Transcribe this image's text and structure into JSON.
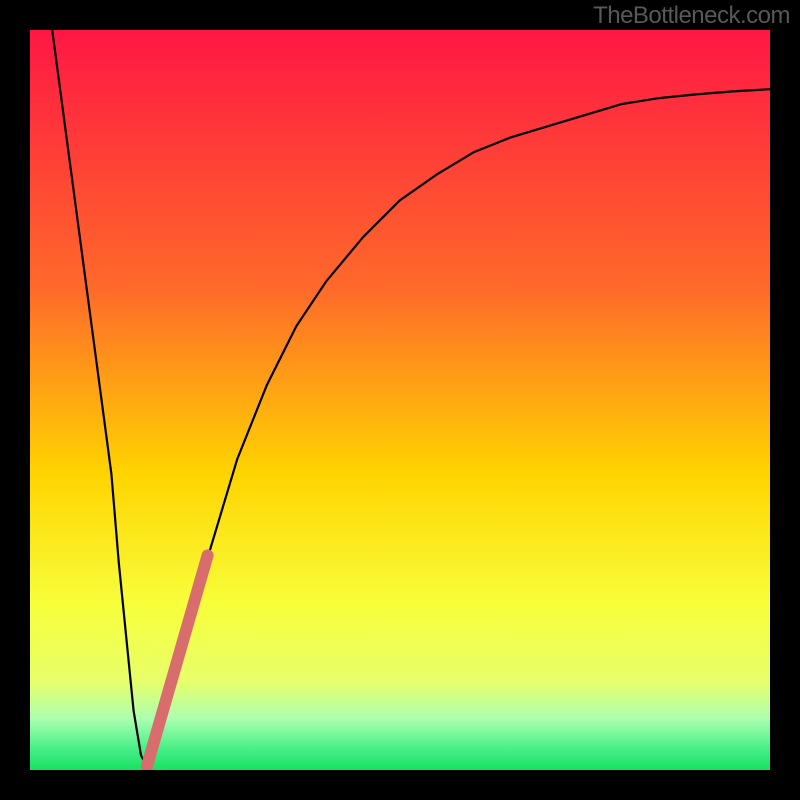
{
  "watermark": "TheBottleneck.com",
  "colors": {
    "top": "#ff1744",
    "upper_mid": "#ff6a2a",
    "mid": "#ffd400",
    "lower_mid": "#f7ff3c",
    "pale_green": "#adffb0",
    "green": "#18e060",
    "frame": "#000000",
    "curve": "#000000",
    "marker": "#d96c6c"
  },
  "chart_data": {
    "type": "line",
    "title": "",
    "xlabel": "",
    "ylabel": "",
    "xlim": [
      0,
      100
    ],
    "ylim": [
      0,
      100
    ],
    "curve": {
      "x": [
        3,
        5,
        7,
        9,
        11,
        12,
        13,
        14,
        15,
        16,
        18,
        20,
        22,
        25,
        28,
        32,
        36,
        40,
        45,
        50,
        55,
        60,
        65,
        70,
        75,
        80,
        85,
        90,
        95,
        100
      ],
      "y": [
        100,
        85,
        70,
        55,
        40,
        28,
        18,
        8,
        2,
        0,
        6,
        14,
        22,
        32,
        42,
        52,
        60,
        66,
        72,
        77,
        80.5,
        83.5,
        85.5,
        87,
        88.5,
        90,
        90.8,
        91.3,
        91.7,
        92
      ]
    },
    "highlight_segment": {
      "x": [
        15.8,
        24
      ],
      "y": [
        0.5,
        29
      ]
    },
    "gradient_stops": [
      {
        "pct": 0,
        "color": "#ff1744"
      },
      {
        "pct": 35,
        "color": "#ff6a2a"
      },
      {
        "pct": 60,
        "color": "#ffd400"
      },
      {
        "pct": 78,
        "color": "#f7ff3c"
      },
      {
        "pct": 88,
        "color": "#e7ff6a"
      },
      {
        "pct": 93,
        "color": "#adffb0"
      },
      {
        "pct": 97,
        "color": "#4af08a"
      },
      {
        "pct": 100,
        "color": "#18e060"
      }
    ]
  }
}
